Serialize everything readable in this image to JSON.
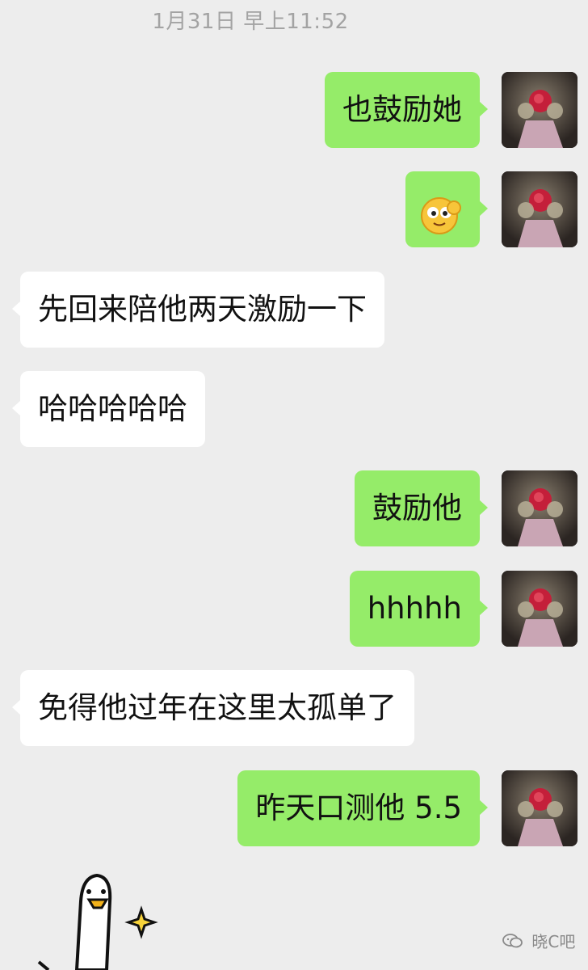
{
  "timestamp": "1月31日 早上11:52",
  "messages": [
    {
      "side": "right",
      "type": "text",
      "text": "也鼓励她"
    },
    {
      "side": "right",
      "type": "emoji",
      "icon": "grinning-face-emoji"
    },
    {
      "side": "left",
      "type": "text",
      "text": "先回来陪他两天激励一下"
    },
    {
      "side": "left",
      "type": "text",
      "text": "哈哈哈哈哈"
    },
    {
      "side": "right",
      "type": "text",
      "text": "鼓励他"
    },
    {
      "side": "right",
      "type": "text",
      "text": "hhhhh"
    },
    {
      "side": "left",
      "type": "text",
      "text": "免得他过年在这里太孤单了"
    },
    {
      "side": "right",
      "type": "text",
      "text": "昨天口测他 5.5"
    }
  ],
  "watermark": {
    "text": "晓C吧",
    "icon": "wechat-channel-icon"
  },
  "sticker": {
    "icon": "goose-sticker",
    "sparkle": "sparkle-icon"
  },
  "colors": {
    "background": "#ededed",
    "bubble_self": "#95ec69",
    "bubble_other": "#ffffff",
    "timestamp": "#a3a3a3"
  }
}
